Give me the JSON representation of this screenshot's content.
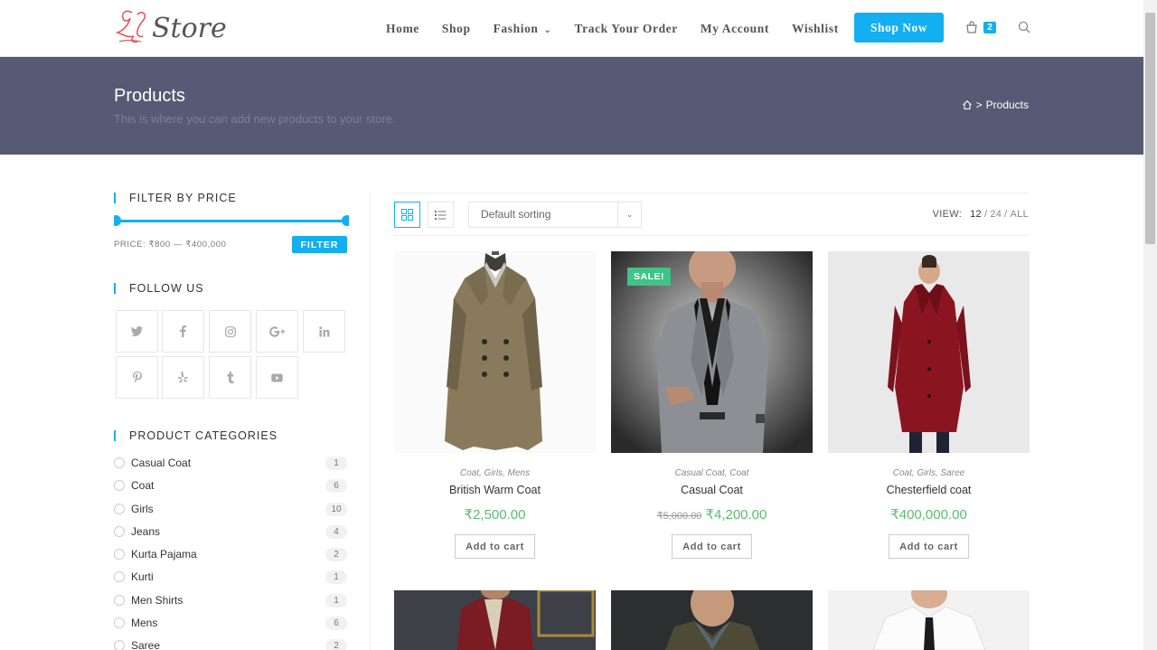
{
  "brand": {
    "logo_text": "Store"
  },
  "nav": {
    "items": [
      "Home",
      "Shop",
      "Fashion",
      "Track Your Order",
      "My Account",
      "Wishlist"
    ],
    "shop_now": "Shop Now",
    "cart_count": "2"
  },
  "page": {
    "title": "Products",
    "subtitle": "This is where you can add new products to your store.",
    "breadcrumb_current": "Products",
    "breadcrumb_sep": ">"
  },
  "sidebar": {
    "filter_title": "FILTER BY PRICE",
    "price_label": "PRICE: ₹800 — ₹400,000",
    "filter_button": "FILTER",
    "follow_title": "FOLLOW US",
    "social_icons": [
      "twitter-icon",
      "facebook-icon",
      "instagram-icon",
      "google-plus-icon",
      "linkedin-icon",
      "pinterest-icon",
      "yelp-icon",
      "tumblr-icon",
      "youtube-icon"
    ],
    "categories_title": "PRODUCT CATEGORIES",
    "categories": [
      {
        "name": "Casual Coat",
        "count": "1"
      },
      {
        "name": "Coat",
        "count": "6"
      },
      {
        "name": "Girls",
        "count": "10"
      },
      {
        "name": "Jeans",
        "count": "4"
      },
      {
        "name": "Kurta Pajama",
        "count": "2"
      },
      {
        "name": "Kurti",
        "count": "1"
      },
      {
        "name": "Men Shirts",
        "count": "1"
      },
      {
        "name": "Mens",
        "count": "6"
      },
      {
        "name": "Saree",
        "count": "2"
      }
    ]
  },
  "toolbar": {
    "sort_value": "Default sorting",
    "view_label": "VIEW:",
    "view_options": [
      "12",
      "24",
      "ALL"
    ],
    "view_sep": "/"
  },
  "products": [
    {
      "categories": "Coat, Girls, Mens",
      "name": "British Warm Coat",
      "price": "₹2,500.00",
      "old_price": "",
      "sale": "",
      "cart": "Add to cart"
    },
    {
      "categories": "Casual Coat, Coat",
      "name": "Casual Coat",
      "price": "₹4,200.00",
      "old_price": "₹5,000.00",
      "sale": "SALE!",
      "cart": "Add to cart"
    },
    {
      "categories": "Coat, Girls, Saree",
      "name": "Chesterfield coat",
      "price": "₹400,000.00",
      "old_price": "",
      "sale": "",
      "cart": "Add to cart"
    }
  ],
  "colors": {
    "accent": "#13aff0",
    "header_band": "#575a74",
    "price": "#57bf6d",
    "sale_badge": "#3fc387"
  }
}
